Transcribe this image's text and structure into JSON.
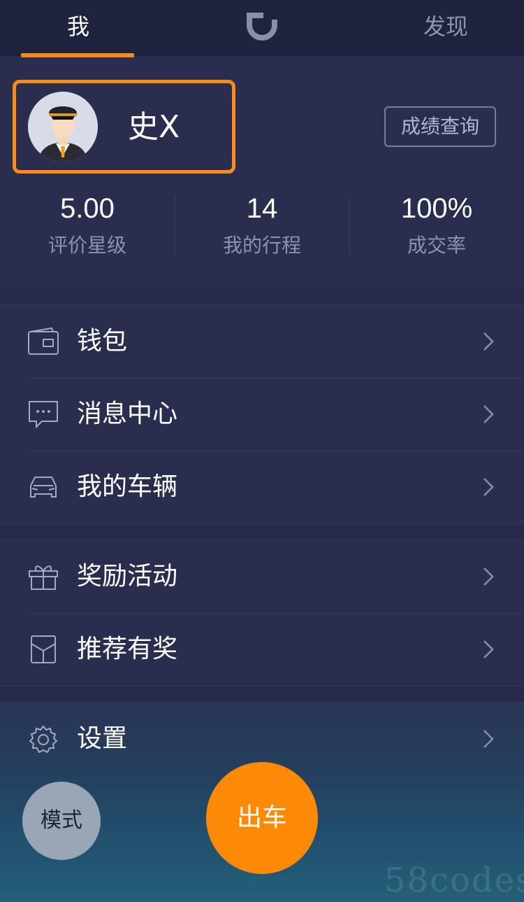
{
  "topbar": {
    "tab_me": "我",
    "tab_discover": "发现",
    "logo_icon": "didi-logo-icon"
  },
  "profile": {
    "name": "史X",
    "score_button": "成绩查询",
    "stats": [
      {
        "value": "5.00",
        "label": "评价星级"
      },
      {
        "value": "14",
        "label": "我的行程"
      },
      {
        "value": "100%",
        "label": "成交率"
      }
    ]
  },
  "menu": {
    "group1": [
      {
        "label": "钱包",
        "icon": "wallet-icon"
      },
      {
        "label": "消息中心",
        "icon": "message-icon"
      },
      {
        "label": "我的车辆",
        "icon": "car-icon"
      }
    ],
    "group2": [
      {
        "label": "奖励活动",
        "icon": "gift-icon"
      },
      {
        "label": "推荐有奖",
        "icon": "envelope-icon"
      }
    ],
    "group3": [
      {
        "label": "设置",
        "icon": "gear-icon"
      }
    ]
  },
  "bottom": {
    "mode_button": "模式",
    "go_button": "出车",
    "watermark": "58codes"
  },
  "colors": {
    "accent": "#fd8a05",
    "background": "#262a48",
    "highlight_border": "#fd8b1a"
  }
}
